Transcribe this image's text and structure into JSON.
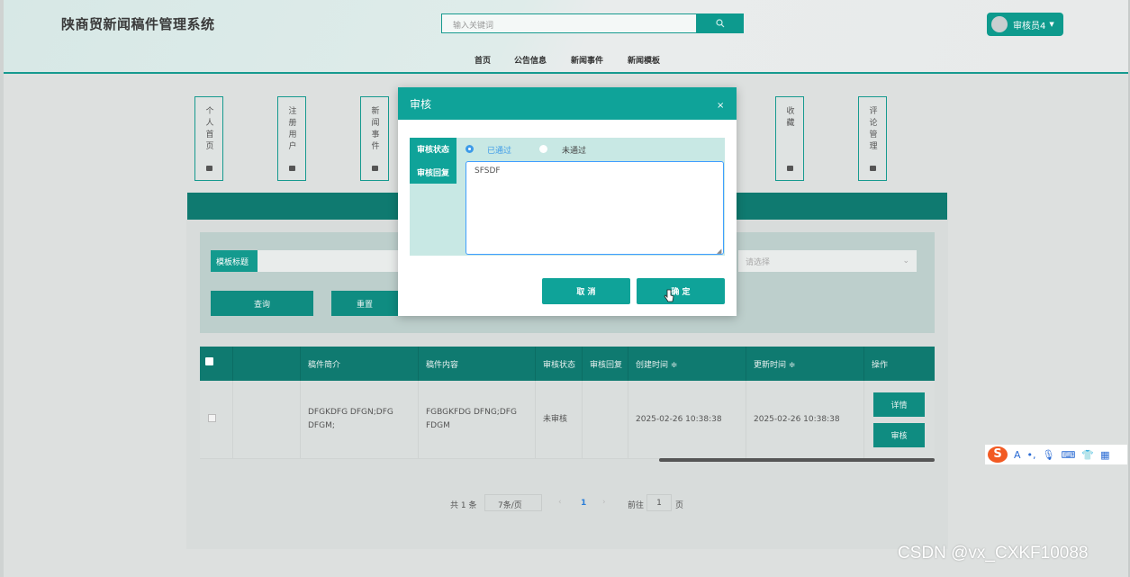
{
  "header": {
    "site_title": "陕商贸新闻稿件管理系统",
    "search_placeholder": "输入关键词",
    "user_label": "审核员4"
  },
  "nav": [
    "首页",
    "公告信息",
    "新闻事件",
    "新闻模板"
  ],
  "quick_cards": [
    "个人首页",
    "注册用户",
    "新闻事件",
    "收藏",
    "评论管理"
  ],
  "search_form": {
    "field_label": "模板标题",
    "select_placeholder": "请选择",
    "query_label": "查询",
    "reset_label": "重置"
  },
  "table": {
    "headers": [
      "稿件简介",
      "稿件内容",
      "审核状态",
      "审核回复",
      "创建时间 ≑",
      "更新时间 ≑",
      "操作"
    ],
    "row": {
      "intro": "DFGKDFG DFGN;DFG DFGM;",
      "content": "FGBGKFDG DFNG;DFG FDGM",
      "status": "未审核",
      "reply": "",
      "created": "2025-02-26 10:38:38",
      "updated": "2025-02-26 10:38:38",
      "detail_label": "详情",
      "review_label": "审核"
    }
  },
  "pagination": {
    "total": "共 1 条",
    "page_size": "7条/页",
    "current_page": "1",
    "goto_label": "前往",
    "goto_value": "1",
    "page_suffix": "页"
  },
  "modal": {
    "title": "审核",
    "close": "×",
    "status_label": "审核状态",
    "reply_label": "审核回复",
    "option_pass": "已通过",
    "option_fail": "未通过",
    "selected": "已通过",
    "reply_value": "SFSDF",
    "cancel_label": "取 消",
    "confirm_label": "确 定"
  },
  "ime": {
    "letter": "A"
  },
  "watermark": "CSDN @vx_CXKF10088",
  "colors": {
    "accent": "#0fa399",
    "dark_teal": "#0f7a70",
    "radio": "#3d9be9"
  }
}
